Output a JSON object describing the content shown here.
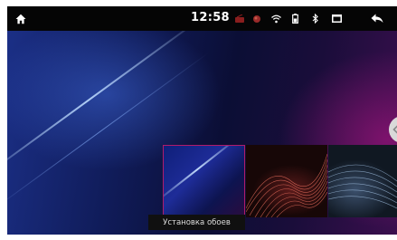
{
  "status_bar": {
    "time": "12:58",
    "icons": [
      "home-icon",
      "radio-icon",
      "gps-icon",
      "wifi-icon",
      "battery-icon",
      "bluetooth-icon",
      "window-icon",
      "back-icon"
    ]
  },
  "wallpaper_picker": {
    "thumbnails": [
      {
        "name": "blue-streak-wallpaper",
        "selected": true
      },
      {
        "name": "red-wave-wallpaper",
        "selected": false
      },
      {
        "name": "blue-mesh-wallpaper",
        "selected": false
      }
    ],
    "caption": "Установка обоев"
  },
  "colors": {
    "selected_border": "#b01b6b",
    "status_bar_bg": "#050505"
  }
}
